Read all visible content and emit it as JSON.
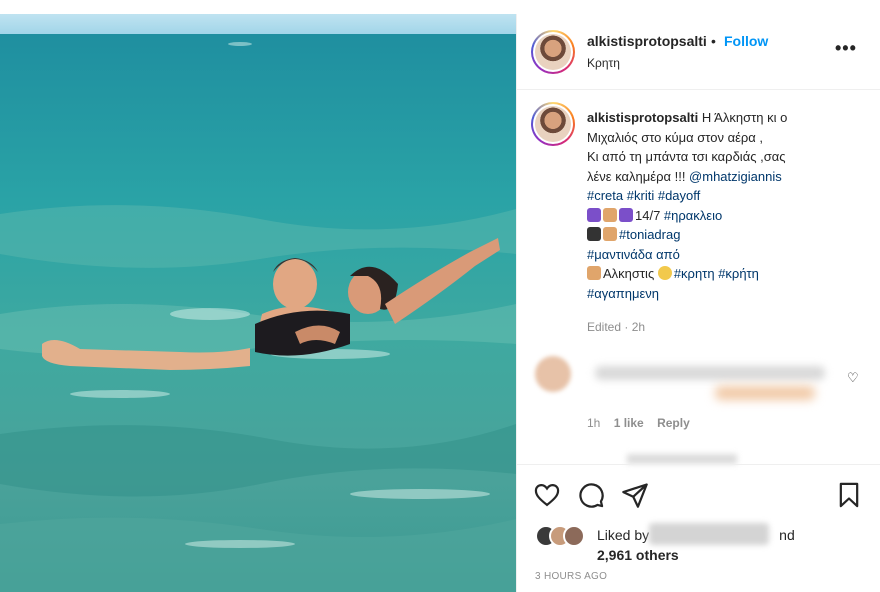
{
  "post": {
    "username": "alkistisprotopsalti",
    "follow_label": "Follow",
    "separator": "•",
    "location": "Κρητη",
    "more_icon": "more-icon"
  },
  "caption": {
    "username": "alkistisprotopsalti",
    "line1": "Η Άλκηστη κι ο",
    "line2": "Μιχαλιός στο κύμα στον αέρα ,",
    "line3": "Κι από τη μπάντα τσι καρδιάς ,σας",
    "line4": "λένε καλημέρα !!! ",
    "mention": "@mhatzigiannis",
    "tags1": [
      "#creta",
      "#kriti",
      "#dayoff"
    ],
    "line6_text": "14/7 ",
    "line6_tag": "#ηρακλειο",
    "line7_tag": "#toniadrag",
    "line8_tag": "#μαντινάδα από",
    "line9_text": "Αλκηστις ",
    "line9_tags": [
      "#κρητη",
      "#κρήτη"
    ],
    "line10_tag": "#αγαπημενη",
    "edited": "Edited · 2h"
  },
  "comment": {
    "time": "1h",
    "likes": "1 like",
    "reply": "Reply"
  },
  "actions": {
    "liked_by": "Liked by",
    "and": "nd",
    "others": "2,961 others",
    "timestamp": "3 HOURS AGO"
  },
  "colors": {
    "follow": "#0095f6",
    "tag": "#00376b",
    "muted": "#8e8e8e"
  }
}
